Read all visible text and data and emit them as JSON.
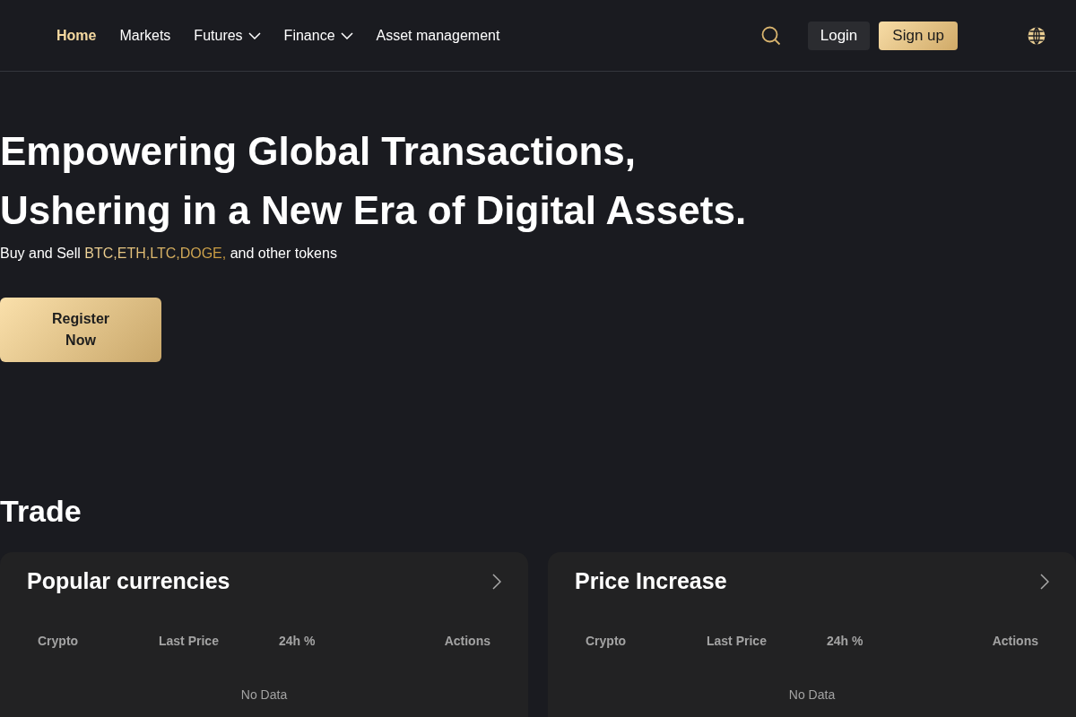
{
  "nav": {
    "items": [
      {
        "label": "Home",
        "selected": true,
        "has_dropdown": false
      },
      {
        "label": "Markets",
        "selected": false,
        "has_dropdown": false
      },
      {
        "label": "Futures",
        "selected": false,
        "has_dropdown": true
      },
      {
        "label": "Finance",
        "selected": false,
        "has_dropdown": true
      },
      {
        "label": "Asset management",
        "selected": false,
        "has_dropdown": false
      }
    ],
    "login": "Login",
    "signup": "Sign up"
  },
  "hero": {
    "title_lines": [
      "Empowering Global Transactions,",
      "Ushering in a New Era of Digital Assets."
    ],
    "subtitle": {
      "lead": "Buy and Sell",
      "tokens": "BTC,ETH,LTC,DOGE,",
      "trail": "and other tokens"
    },
    "cta": "Register Now"
  },
  "trade": {
    "heading": "Trade",
    "cards": [
      {
        "title": "Popular currencies",
        "columns": [
          "Crypto",
          "Last Price",
          "24h %",
          "Actions"
        ],
        "empty_text": "No Data"
      },
      {
        "title": "Price Increase",
        "columns": [
          "Crypto",
          "Last Price",
          "24h %",
          "Actions"
        ],
        "empty_text": "No Data"
      }
    ]
  }
}
